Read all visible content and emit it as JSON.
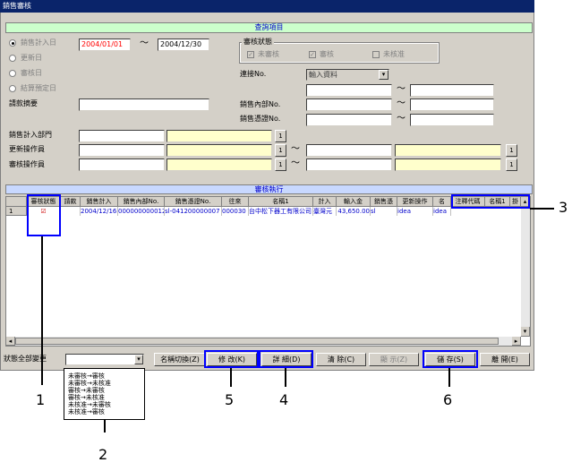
{
  "window": {
    "title": "銷售審核"
  },
  "query_section": {
    "title": "查詢項目"
  },
  "date_radios": [
    {
      "label": "銷售計入日",
      "selected": true,
      "enabled": true
    },
    {
      "label": "更新日",
      "selected": false,
      "enabled": false
    },
    {
      "label": "審核日",
      "selected": false,
      "enabled": false
    },
    {
      "label": "結算預定日",
      "selected": false,
      "enabled": false
    }
  ],
  "date_from": "2004/01/01",
  "date_to": "2004/12/30",
  "tilde": "〜",
  "review_status": {
    "title": "審核狀態",
    "options": [
      {
        "label": "未審核",
        "checked": true
      },
      {
        "label": "審核",
        "checked": true
      },
      {
        "label": "未核准",
        "checked": false
      }
    ]
  },
  "fields": {
    "contact_no": "連接No.",
    "contact_select": "輸入資料",
    "request_summary": "請款摘要",
    "sales_internal_no": "銷售內部No.",
    "sales_slip_no": "銷售憑證No.",
    "sales_dept": "銷售計入部門",
    "update_operator": "更新操作員",
    "review_operator": "審核操作員",
    "lookup_button": "1"
  },
  "exec_section": {
    "title": "審核執行"
  },
  "grid": {
    "columns": [
      "審核狀態",
      "請款",
      "銷售計入",
      "銷售內部No.",
      "銷售憑證No.",
      "往來",
      "名稱1",
      "計入",
      "輸入金",
      "銷售憑",
      "更新操作",
      "名",
      "注釋代碼",
      "名稱1",
      "掛"
    ],
    "rows": [
      {
        "num": "1",
        "status_mark": "☑",
        "request": "",
        "date": "2004/12/16",
        "internal_no": "000000000012",
        "slip_no": "sl-041200000007",
        "partner": "000030",
        "name": "台中松下器工有限公司",
        "entry": "臺灣元",
        "amount": "43,650.00",
        "slip": "sl",
        "operator": "idea",
        "n": "idea",
        "note": "",
        "name1": "",
        "hang": ""
      }
    ]
  },
  "footer": {
    "status_all_label": "狀態全部變更",
    "status_select_value": "",
    "buttons": {
      "name_switch": "名稱切換(Z)",
      "modify": "修 改(K)",
      "detail": "詳 細(D)",
      "clear": "清 除(C)",
      "display": "顯 示(Z)",
      "save": "儲 存(S)",
      "close": "離 開(E)"
    }
  },
  "status_options": [
    "未審核→審核",
    "未審核→未核准",
    "審核→未審核",
    "審核→未核准",
    "未核准→未審核",
    "未核准→審核"
  ],
  "callouts": [
    "1",
    "2",
    "3",
    "4",
    "5",
    "6"
  ]
}
